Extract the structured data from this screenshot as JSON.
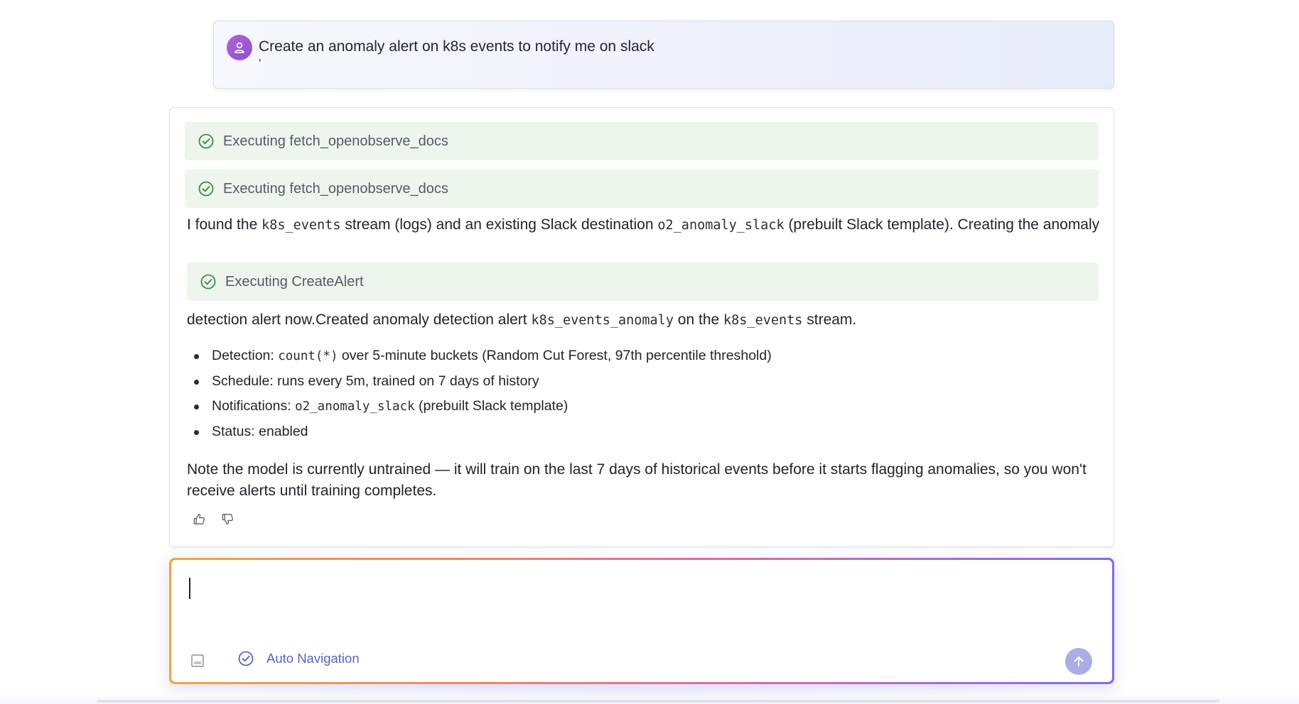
{
  "user_message": {
    "text": "Create an anomaly alert on k8s events to notify me on slack",
    "trailing": "'"
  },
  "response": {
    "tool_calls": [
      {
        "label": "Executing fetch_openobserve_docs",
        "status_color": "#3a8a4a"
      },
      {
        "label": "Executing fetch_openobserve_docs",
        "status_color": "#3a8a4a"
      },
      {
        "label": "Executing CreateAlert",
        "status_color": "#3a8a4a"
      }
    ],
    "paragraph1": {
      "t1": "I found the ",
      "c1": "k8s_events",
      "t2": " stream (logs) and an existing Slack destination ",
      "c2": "o2_anomaly_slack",
      "t3": " (prebuilt Slack template). Creating the anomaly"
    },
    "paragraph2": {
      "t1": "detection alert now.Created anomaly detection alert ",
      "c1": "k8s_events_anomaly",
      "t2": " on the ",
      "c2": "k8s_events",
      "t3": " stream."
    },
    "bullets": [
      {
        "prefix": "Detection: ",
        "code": "count(*)",
        "suffix": " over 5-minute buckets (Random Cut Forest, 97th percentile threshold)"
      },
      {
        "prefix": "Schedule: runs every 5m, trained on 7 days of history",
        "code": "",
        "suffix": ""
      },
      {
        "prefix": "Notifications: ",
        "code": "o2_anomaly_slack",
        "suffix": " (prebuilt Slack template)"
      },
      {
        "prefix": "Status: enabled",
        "code": "",
        "suffix": ""
      }
    ],
    "note": "Note the model is currently untrained — it will train on the last 7 days of historical events before it starts flagging anomalies, so you won't receive alerts until training completes.",
    "feedback": {
      "like_icon": "thumbs-up-icon",
      "dislike_icon": "thumbs-down-icon"
    }
  },
  "composer": {
    "value": "",
    "placeholder": "",
    "auto_navigation_label": "Auto Navigation",
    "auto_navigation_enabled": true,
    "attach_icon": "image-icon",
    "send_icon": "arrow-up-icon"
  },
  "colors": {
    "accent": "#5b63c9",
    "success": "#3a8a4a",
    "tool_bg": "#eef5ec",
    "avatar": "#9b59d6",
    "send_btn": "#a9aee8"
  }
}
